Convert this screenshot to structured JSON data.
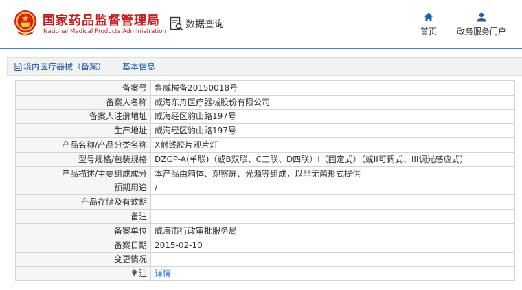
{
  "header": {
    "org_cn": "国家药品监督管理局",
    "org_en": "National Medical Products Administration",
    "data_query_label": "数据查询",
    "nav": [
      {
        "label": "首页",
        "icon": "home-icon"
      },
      {
        "label": "政务服务门户",
        "icon": "user-icon"
      }
    ],
    "accent_color": "#c91b1b",
    "rule_color": "#3f82c7"
  },
  "section": {
    "title": "境内医疗器械（备案）——基本信息"
  },
  "rows": [
    {
      "label": "备案号",
      "value": "鲁威械备20150018号"
    },
    {
      "label": "备案人名称",
      "value": "威海东舟医疗器械股份有限公司"
    },
    {
      "label": "备案人注册地址",
      "value": "威海经区豹山路197号"
    },
    {
      "label": "生产地址",
      "value": "威海经区豹山路197号"
    },
    {
      "label": "产品名称/产品分类名称",
      "value": "X射线胶片观片灯"
    },
    {
      "label": "型号规格/包装规格",
      "value": "DZGP-A(单联)（或B双联、C三联、D四联）I（固定式）（或II可调式、III调光感应式）"
    },
    {
      "label": "产品描述/主要组成成分",
      "value": "本产品由箱体、观察屏、光源等组成，以非无菌形式提供"
    },
    {
      "label": "预期用途",
      "value": "/"
    },
    {
      "label": "产品存储及有效期",
      "value": ""
    },
    {
      "label": "备注",
      "value": ""
    },
    {
      "label": "备案单位",
      "value": "威海市行政审批服务局"
    },
    {
      "label": "备案日期",
      "value": "2015-02-10"
    },
    {
      "label": "变更情况",
      "value": ""
    }
  ],
  "note_row": {
    "label": "注",
    "link": "详情"
  }
}
